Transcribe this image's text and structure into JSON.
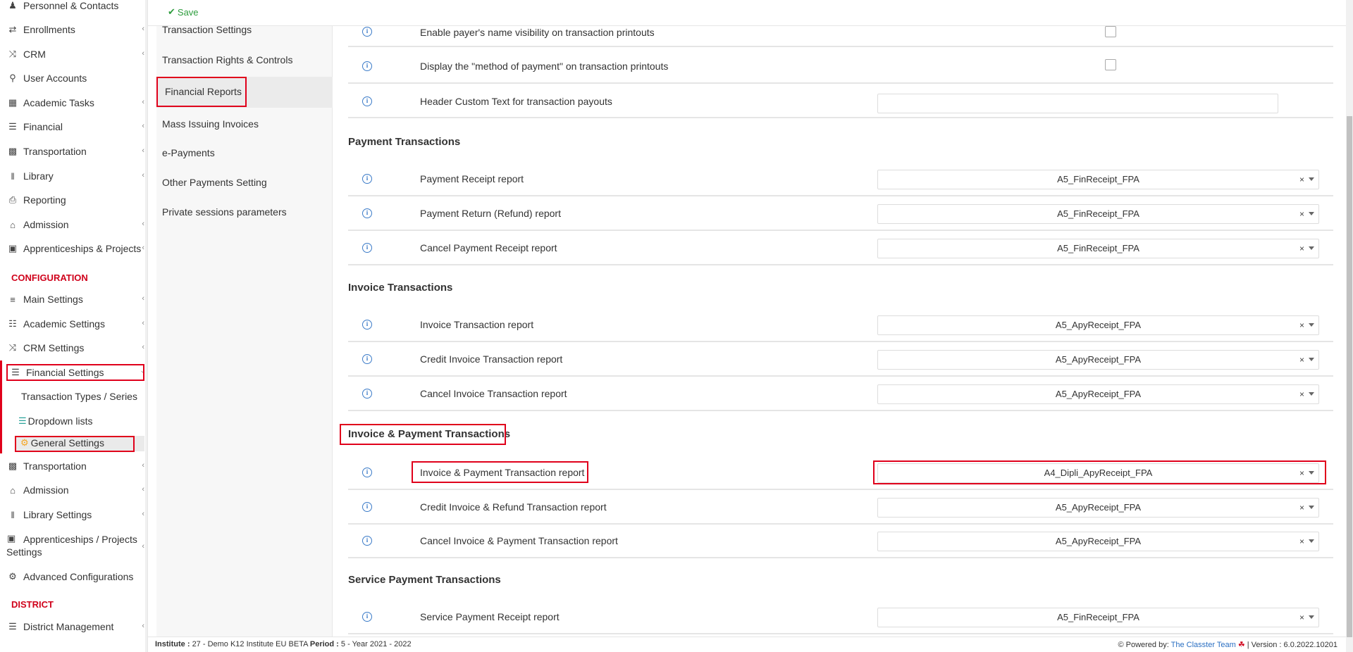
{
  "sidebar": {
    "items": [
      {
        "label": "Personnel & Contacts",
        "icon": "person-icon"
      },
      {
        "label": "Enrollments",
        "icon": "arrows-icon"
      },
      {
        "label": "CRM",
        "icon": "shuffle-icon"
      },
      {
        "label": "User Accounts",
        "icon": "key-icon"
      },
      {
        "label": "Academic Tasks",
        "icon": "grid-icon"
      },
      {
        "label": "Financial",
        "icon": "coins-icon"
      },
      {
        "label": "Transportation",
        "icon": "bus-icon"
      },
      {
        "label": "Library",
        "icon": "books-icon"
      },
      {
        "label": "Reporting",
        "icon": "printer-icon"
      },
      {
        "label": "Admission",
        "icon": "building-icon"
      },
      {
        "label": "Apprenticeships & Projects",
        "icon": "box-icon"
      }
    ],
    "config_section": "CONFIGURATION",
    "config_items": [
      {
        "label": "Main Settings",
        "icon": "sliders-icon"
      },
      {
        "label": "Academic Settings",
        "icon": "people-icon"
      },
      {
        "label": "CRM Settings",
        "icon": "shuffle-icon"
      },
      {
        "label": "Financial Settings",
        "icon": "coins-icon"
      }
    ],
    "financial_sub": [
      "Transaction Types / Series",
      "Dropdown lists",
      "General Settings"
    ],
    "config_items2": [
      {
        "label": "Transportation",
        "icon": "bus-icon"
      },
      {
        "label": "Admission",
        "icon": "building-icon"
      },
      {
        "label": "Library Settings",
        "icon": "books-icon"
      },
      {
        "label": "Apprenticeships / Projects",
        "label2": "Settings",
        "icon": "box-icon"
      },
      {
        "label": "Advanced Configurations",
        "icon": "gears-icon"
      }
    ],
    "district_section": "DISTRICT",
    "district_items": [
      {
        "label": "District Management",
        "icon": "list-icon"
      }
    ]
  },
  "toolbar": {
    "save_label": "Save"
  },
  "submenu": [
    "Transaction Settings",
    "Transaction Rights & Controls",
    "Financial Reports",
    "Mass Issuing Invoices",
    "e-Payments",
    "Other Payments Setting",
    "Private sessions parameters"
  ],
  "top_rows": [
    {
      "label": "Enable payer's name visibility on transaction printouts"
    },
    {
      "label": "Display the \"method of payment\" on transaction printouts"
    },
    {
      "label": "Header Custom Text for transaction payouts"
    }
  ],
  "sections": [
    {
      "title": "Payment Transactions",
      "rows": [
        {
          "label": "Payment Receipt report",
          "value": "A5_FinReceipt_FPA"
        },
        {
          "label": "Payment Return (Refund) report",
          "value": "A5_FinReceipt_FPA"
        },
        {
          "label": "Cancel Payment Receipt report",
          "value": "A5_FinReceipt_FPA"
        }
      ]
    },
    {
      "title": "Invoice Transactions",
      "rows": [
        {
          "label": "Invoice Transaction report",
          "value": "A5_ApyReceipt_FPA"
        },
        {
          "label": "Credit Invoice Transaction report",
          "value": "A5_ApyReceipt_FPA"
        },
        {
          "label": "Cancel Invoice Transaction report",
          "value": "A5_ApyReceipt_FPA"
        }
      ]
    },
    {
      "title": "Invoice & Payment Transactions",
      "rows": [
        {
          "label": "Invoice & Payment Transaction report",
          "value": "A4_Dipli_ApyReceipt_FPA"
        },
        {
          "label": "Credit Invoice & Refund Transaction report",
          "value": "A5_ApyReceipt_FPA"
        },
        {
          "label": "Cancel Invoice & Payment Transaction report",
          "value": "A5_ApyReceipt_FPA"
        }
      ]
    },
    {
      "title": "Service Payment Transactions",
      "rows": [
        {
          "label": "Service Payment Receipt report",
          "value": "A5_FinReceipt_FPA"
        }
      ]
    }
  ],
  "select_clear": "×",
  "info_glyph": "i",
  "footer": {
    "institute_label": "Institute :",
    "institute_value": "27 - Demo K12 Institute EU BETA",
    "period_label": "Period :",
    "period_value": "5 - Year 2021 - 2022",
    "powered_label": "Powered by:",
    "powered_link": "The Classter Team",
    "version_text": "| Version : 6.0.2022.10201"
  },
  "colors": {
    "accent_red": "#e0001b",
    "section_red": "#d0021b",
    "save_green": "#2e9d3e",
    "info_blue": "#3b7bc8"
  }
}
